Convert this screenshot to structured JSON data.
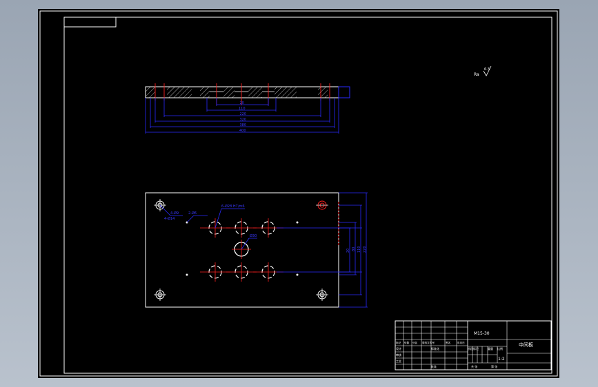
{
  "drawing": {
    "surface_finish_note": "Ra",
    "surface_finish_value": "6.3",
    "colors": {
      "background": "#000000",
      "outline": "#ffffff",
      "centerline": "#ff2020",
      "dimension": "#2a2aff",
      "hidden": "#ffffff"
    }
  },
  "section_view": {
    "dimension_labels": [
      "20",
      "110",
      "220",
      "320",
      "380",
      "400"
    ]
  },
  "plan_view": {
    "hole_labels": {
      "counterbore": "4-Ø9",
      "counterbore_depth": "4-Ø14",
      "pin_holes": "2-Ø6",
      "guide_bushing": "6-Ø28 H7/m6",
      "center_hole": "Ø30"
    },
    "vertical_dimensions": [
      "20",
      "80",
      "110",
      "220"
    ]
  },
  "title_block": {
    "drawing_number": "M15-30",
    "part_name": "中间板",
    "scale": "1:2",
    "row_labels": [
      "标记",
      "处数",
      "分区",
      "更改文件号",
      "签名",
      "年月日"
    ],
    "design": "设计",
    "standardize": "标准化",
    "review": "审核",
    "process": "工艺",
    "approve": "批准",
    "stage_mark": "阶段标记",
    "weight": "重量",
    "ratio": "比例",
    "sheets_total": "共  张",
    "sheet_no": "第  张"
  }
}
